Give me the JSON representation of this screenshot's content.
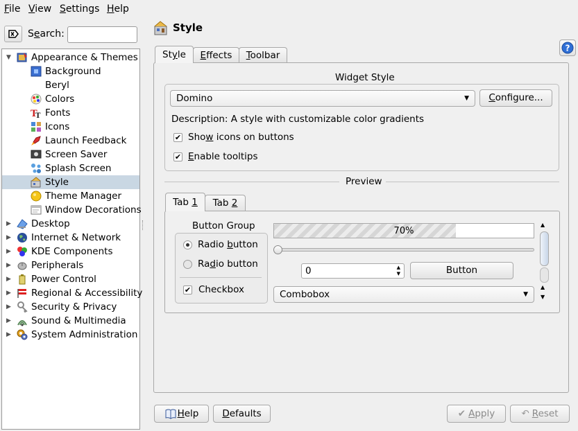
{
  "menubar": {
    "items": [
      {
        "pre": "",
        "u": "F",
        "post": "ile"
      },
      {
        "pre": "",
        "u": "V",
        "post": "iew"
      },
      {
        "pre": "",
        "u": "S",
        "post": "ettings"
      },
      {
        "pre": "",
        "u": "H",
        "post": "elp"
      }
    ]
  },
  "search": {
    "label_pre": "S",
    "label_u": "e",
    "label_post": "arch:",
    "value": ""
  },
  "tree": {
    "items": [
      {
        "label": "Appearance & Themes",
        "icon": "appearance-icon",
        "expanded": true
      },
      {
        "label": "Background",
        "icon": "background-icon"
      },
      {
        "label": "Beryl",
        "icon": ""
      },
      {
        "label": "Colors",
        "icon": "colors-icon"
      },
      {
        "label": "Fonts",
        "icon": "fonts-icon"
      },
      {
        "label": "Icons",
        "icon": "icons-icon"
      },
      {
        "label": "Launch Feedback",
        "icon": "rocket-icon"
      },
      {
        "label": "Screen Saver",
        "icon": "screensaver-icon"
      },
      {
        "label": "Splash Screen",
        "icon": "splash-icon"
      },
      {
        "label": "Style",
        "icon": "style-icon",
        "selected": true
      },
      {
        "label": "Theme Manager",
        "icon": "theme-manager-icon"
      },
      {
        "label": "Window Decorations",
        "icon": "window-decorations-icon"
      },
      {
        "label": "Desktop",
        "icon": "desktop-icon"
      },
      {
        "label": "Internet & Network",
        "icon": "globe-icon"
      },
      {
        "label": "KDE Components",
        "icon": "components-icon"
      },
      {
        "label": "Peripherals",
        "icon": "mouse-icon"
      },
      {
        "label": "Power Control",
        "icon": "power-icon"
      },
      {
        "label": "Regional & Accessibility",
        "icon": "flag-icon"
      },
      {
        "label": "Security & Privacy",
        "icon": "security-icon"
      },
      {
        "label": "Sound & Multimedia",
        "icon": "sound-icon"
      },
      {
        "label": "System Administration",
        "icon": "system-admin-icon"
      }
    ]
  },
  "header": {
    "title": "Style"
  },
  "tabs": [
    {
      "pre": "St",
      "u": "y",
      "post": "le"
    },
    {
      "pre": "",
      "u": "E",
      "post": "ffects"
    },
    {
      "pre": "",
      "u": "T",
      "post": "oolbar"
    }
  ],
  "widget_style": {
    "title": "Widget Style",
    "combo_value": "Domino",
    "configure": {
      "pre": "",
      "u": "C",
      "post": "onfigure..."
    },
    "description": "Description: A style with customizable color gradients",
    "show_icons": {
      "pre": "Sho",
      "u": "w",
      "post": " icons on buttons",
      "checked": true
    },
    "tooltips": {
      "pre": "",
      "u": "E",
      "post": "nable tooltips",
      "checked": true
    }
  },
  "preview": {
    "title": "Preview",
    "tabs": [
      {
        "pre": "Tab ",
        "u": "1",
        "post": ""
      },
      {
        "pre": "Tab ",
        "u": "2",
        "post": ""
      }
    ],
    "button_group": "Button Group",
    "radio1": {
      "pre": "Radio ",
      "u": "b",
      "post": "utton",
      "checked": true
    },
    "radio2": {
      "pre": "Ra",
      "u": "d",
      "post": "io button",
      "checked": false
    },
    "checkbox": {
      "label": "Checkbox",
      "checked": true
    },
    "progress_label": "70%",
    "progress_value": 0.7,
    "slider_value": 0,
    "spin_value": "0",
    "button_label": "Button",
    "combobox": "Combobox"
  },
  "footer": {
    "help": {
      "pre": "",
      "u": "H",
      "post": "elp"
    },
    "defaults": {
      "pre": "",
      "u": "D",
      "post": "efaults"
    },
    "apply": {
      "pre": "",
      "u": "A",
      "post": "pply"
    },
    "reset": {
      "pre": "",
      "u": "R",
      "post": "eset"
    }
  }
}
